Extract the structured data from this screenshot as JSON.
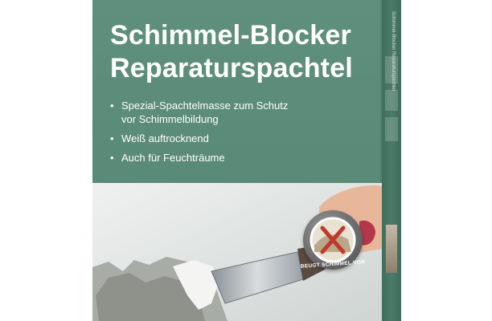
{
  "product": {
    "title_line1": "Schimmel-Blocker",
    "title_line2": "Reparaturspachtel",
    "bullets": [
      "Spezial-Spachtelmasse zum Schutz",
      "vor Schimmelbildung",
      "Weiß auftrocknend",
      "Auch für Feuchträume"
    ],
    "badge_text": "BEUGT SCHIMMEL VOR",
    "side_text": "Schimmel-Blocker Reparaturspachtel"
  },
  "colors": {
    "panel": "#5b8b79",
    "side_panel": "#4a7a68",
    "text": "#ffffff",
    "badge_cross": "#c0392b",
    "wall": "#dfe3e2"
  }
}
